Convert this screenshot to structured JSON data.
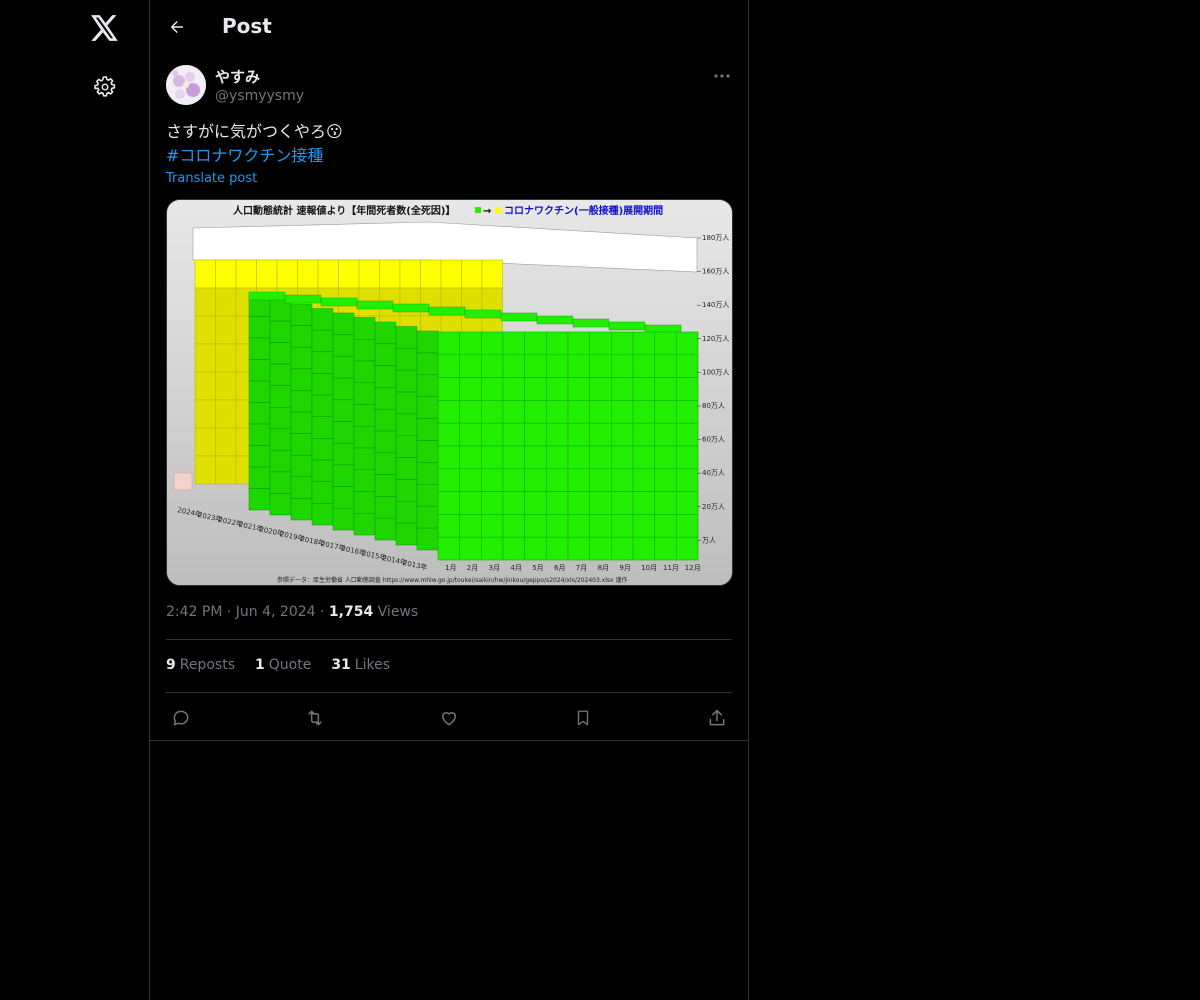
{
  "header": {
    "title": "Post"
  },
  "user": {
    "name": "やすみ",
    "handle": "@ysmyysmy"
  },
  "post": {
    "text": "さすがに気がつくやろ😗",
    "hashtag": "#コロナワクチン接種",
    "translate_label": "Translate post",
    "time": "2:42 PM",
    "date": "Jun 4, 2024",
    "views_count": "1,754",
    "views_label": "Views"
  },
  "stats": {
    "reposts_count": "9",
    "reposts_label": "Reposts",
    "quote_count": "1",
    "quote_label": "Quote",
    "likes_count": "31",
    "likes_label": "Likes"
  },
  "chart_image": {
    "title_left": "人口動態統計 速報値より【年間死者数(全死因)】",
    "title_arrow": "→",
    "title_right": "コロナワクチン(一般接種)展開期間",
    "y_ticks": [
      "180万人",
      "160万人",
      "140万人",
      "120万人",
      "100万人",
      "80万人",
      "60万人",
      "40万人",
      "20万人",
      "万人"
    ],
    "x_ticks": [
      "1月",
      "2月",
      "3月",
      "4月",
      "5月",
      "6月",
      "7月",
      "8月",
      "9月",
      "10月",
      "11月",
      "12月"
    ],
    "z_ticks": [
      "2024年",
      "2023年",
      "2022年",
      "2021年",
      "2020年",
      "2019年",
      "2018年",
      "2017年",
      "2016年",
      "2015年",
      "2014年",
      "2013年"
    ],
    "source": "参照データ：厚生労働省 人口動態調査 https://www.mhlw.go.jp/toukei/saikin/hw/jinkou/geppo/s2024/xls/202403.xlsx 谨作",
    "colors": {
      "green": "#22ee00",
      "yellow": "#ffff00",
      "link": "#1d9bf0"
    }
  }
}
